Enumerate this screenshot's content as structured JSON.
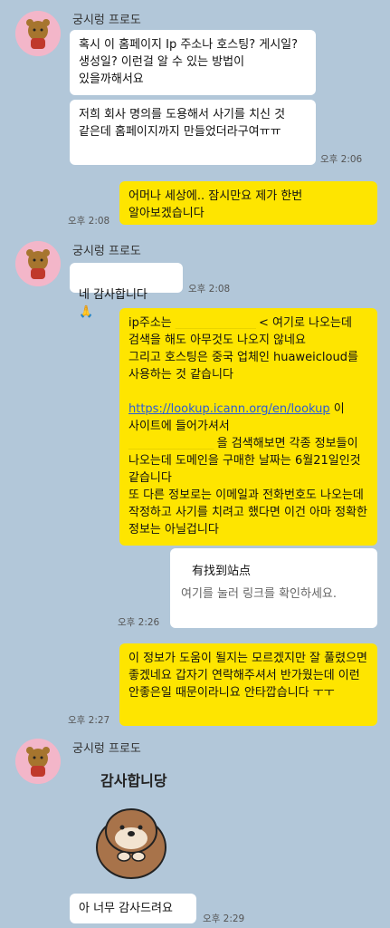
{
  "chat": {
    "sender_name": "궁시렁 프로도",
    "messages": {
      "m1": "혹시 이 홈페이지 Ip 주소나 호스팅? 게시일? 생성일? 이런걸 알 수 있는 방법이 있을까해서요",
      "m2": "저희 회사 명의를 도용해서 사기를 치신 것 같은데 홈페이지까지 만들었더라구여ㅠㅠ",
      "m3": "어머나 세상에.. 잠시만요 제가 한번 알아보겠습니다",
      "m4": "네 감사합니다",
      "m5_a": "ip주소는 ",
      "m5_b": " < 여기로 나오는데 검색을 해도 아무것도 나오지 않네요\n그리고 호스팅은 중국 업체인 huaweicloud를 사용하는 것 같습니다\n\n",
      "m5_link": "https://lookup.icann.org/en/lookup",
      "m5_c": " 이 사이트에 들어가셔서\n",
      "m5_d": " 을 검색해보면 각종 정보들이 나오는데 도메인을 구매한 날짜는 6월21일인것 같습니다\n또 다른 정보로는 이메일과 전화번호도 나오는데 작정하고 사기를 치려고 했다면 이건 아마 정확한 정보는 아닐겁니다",
      "card_title": "有找到站点",
      "card_sub": "여기를 눌러 링크를 확인하세요.",
      "m6": "이 정보가 도움이 될지는 모르겠지만 잘 풀렸으면 좋겠네요 갑자기 연락해주셔서 반가웠는데 이런 안좋은일 때문이라니요 안타깝습니다 ㅜㅜ",
      "sticker_text": "감사합니당",
      "m7": "아 너무 감사드려요"
    },
    "times": {
      "t1": "오후 2:06",
      "t2": "오후 2:08",
      "t3": "오후 2:08",
      "t4": "오후 2:26",
      "t5": "오후 2:27",
      "t6": "오후 2:29"
    }
  }
}
